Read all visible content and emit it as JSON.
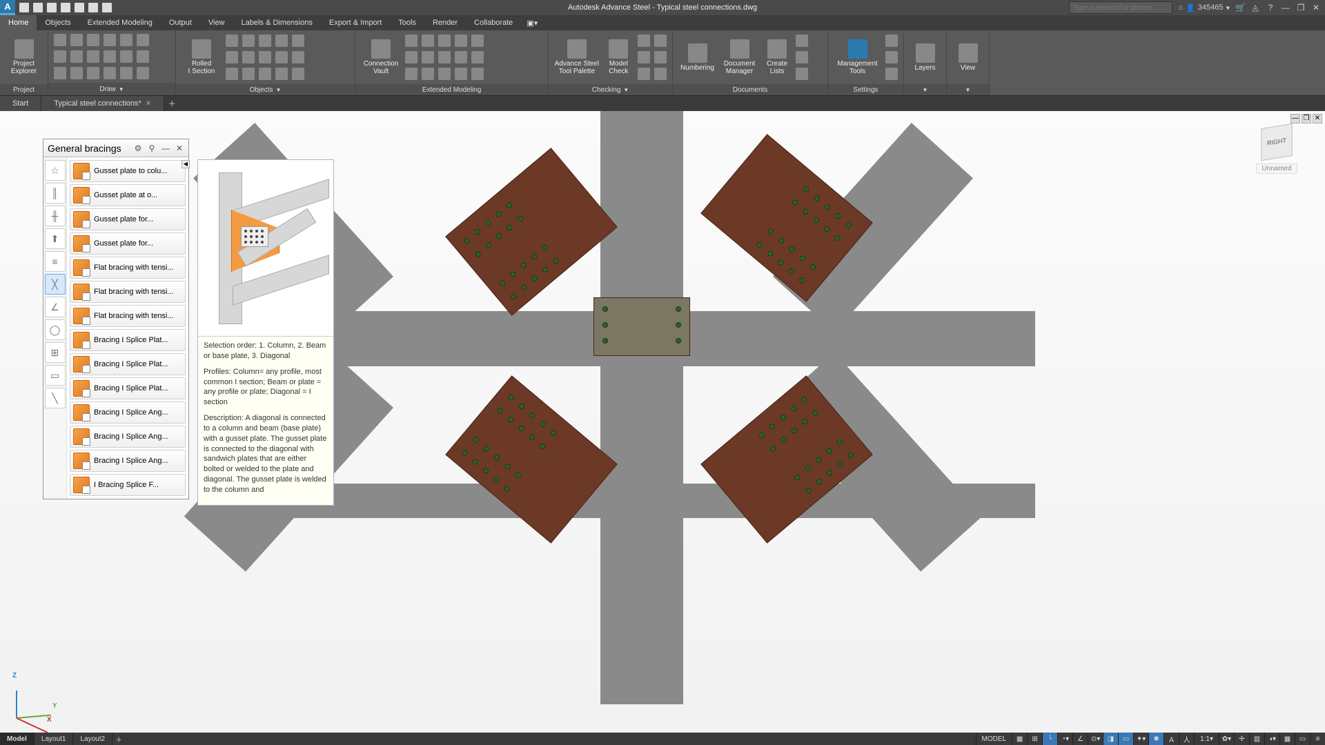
{
  "app": {
    "title": "Autodesk Advance Steel - Typical steel connections.dwg"
  },
  "titlebar": {
    "search_placeholder": "Type a keyword or phrase",
    "user_id": "345465"
  },
  "ribbon_tabs": [
    "Home",
    "Objects",
    "Extended Modeling",
    "Output",
    "View",
    "Labels & Dimensions",
    "Export & Import",
    "Tools",
    "Render",
    "Collaborate"
  ],
  "ribbon_active_tab": 0,
  "ribbon_panels": {
    "project": {
      "title": "Project",
      "btn": "Project\nExplorer"
    },
    "draw": {
      "title": "Draw"
    },
    "objects": {
      "title": "Objects",
      "btn": "Rolled\nI Section"
    },
    "ext": {
      "title": "Extended Modeling",
      "btn": "Connection\nVault"
    },
    "checking": {
      "title": "Checking",
      "btn1": "Advance Steel\nTool Palette",
      "btn2": "Model\nCheck"
    },
    "documents": {
      "title": "Documents",
      "btn1": "Numbering",
      "btn2": "Document\nManager",
      "btn3": "Create\nLists"
    },
    "settings": {
      "title": "Settings",
      "btn": "Management\nTools"
    },
    "layers": {
      "title": "",
      "btn": "Layers"
    },
    "view": {
      "title": "",
      "btn": "View"
    }
  },
  "doc_tabs": {
    "start": "Start",
    "file": "Typical steel connections*"
  },
  "palette": {
    "title": "General bracings",
    "items": [
      "Gusset plate to colu...",
      "Gusset plate at o...",
      "Gusset plate for...",
      "Gusset plate for...",
      "Flat bracing with tensi...",
      "Flat bracing with tensi...",
      "Flat bracing with tensi...",
      "Bracing I Splice Plat...",
      "Bracing I Splice Plat...",
      "Bracing I Splice Plat...",
      "Bracing I Splice Ang...",
      "Bracing I Splice Ang...",
      "Bracing I Splice Ang...",
      "I Bracing Splice F..."
    ],
    "active_side_tab": 5
  },
  "tooltip": {
    "p1": "Selection order: 1. Column, 2. Beam or base plate, 3. Diagonal",
    "p2": "Profiles: Column= any profile, most common I section; Beam or plate = any profile or plate; Diagonal = I section",
    "p3": "Description: A diagonal is connected to a column and beam (base plate) with a gusset plate. The gusset plate is connected to the diagonal with sandwich plates that are either bolted or welded to the plate and diagonal. The gusset plate is welded to the column and"
  },
  "viewcube": {
    "face": "RIGHT",
    "named": "Unnamed"
  },
  "ucs": {
    "x": "X",
    "y": "Y",
    "z": "Z"
  },
  "status": {
    "tabs": [
      "Model",
      "Layout1",
      "Layout2"
    ],
    "active": 0,
    "model_label": "MODEL",
    "scale": "1:1"
  }
}
